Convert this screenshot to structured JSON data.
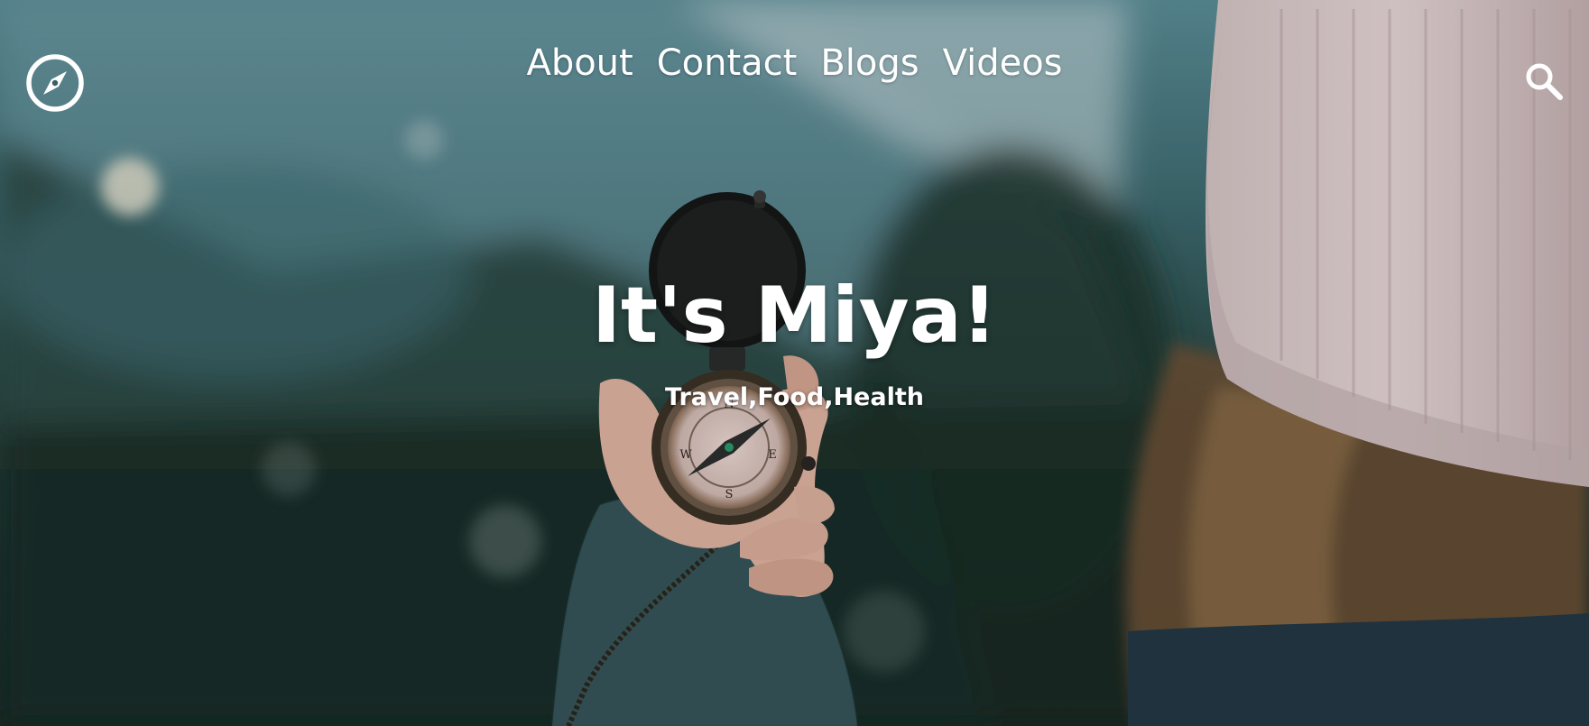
{
  "header": {
    "logo_icon": "compass-icon",
    "search_icon": "search-icon",
    "nav": [
      {
        "label": "About"
      },
      {
        "label": "Contact"
      },
      {
        "label": "Blogs"
      },
      {
        "label": "Videos"
      }
    ]
  },
  "hero": {
    "title": "It's Miya!",
    "subtitle": "Travel,Food,Health",
    "background": "photo-hand-holding-compass-mountains",
    "text_color": "#ffffff"
  }
}
